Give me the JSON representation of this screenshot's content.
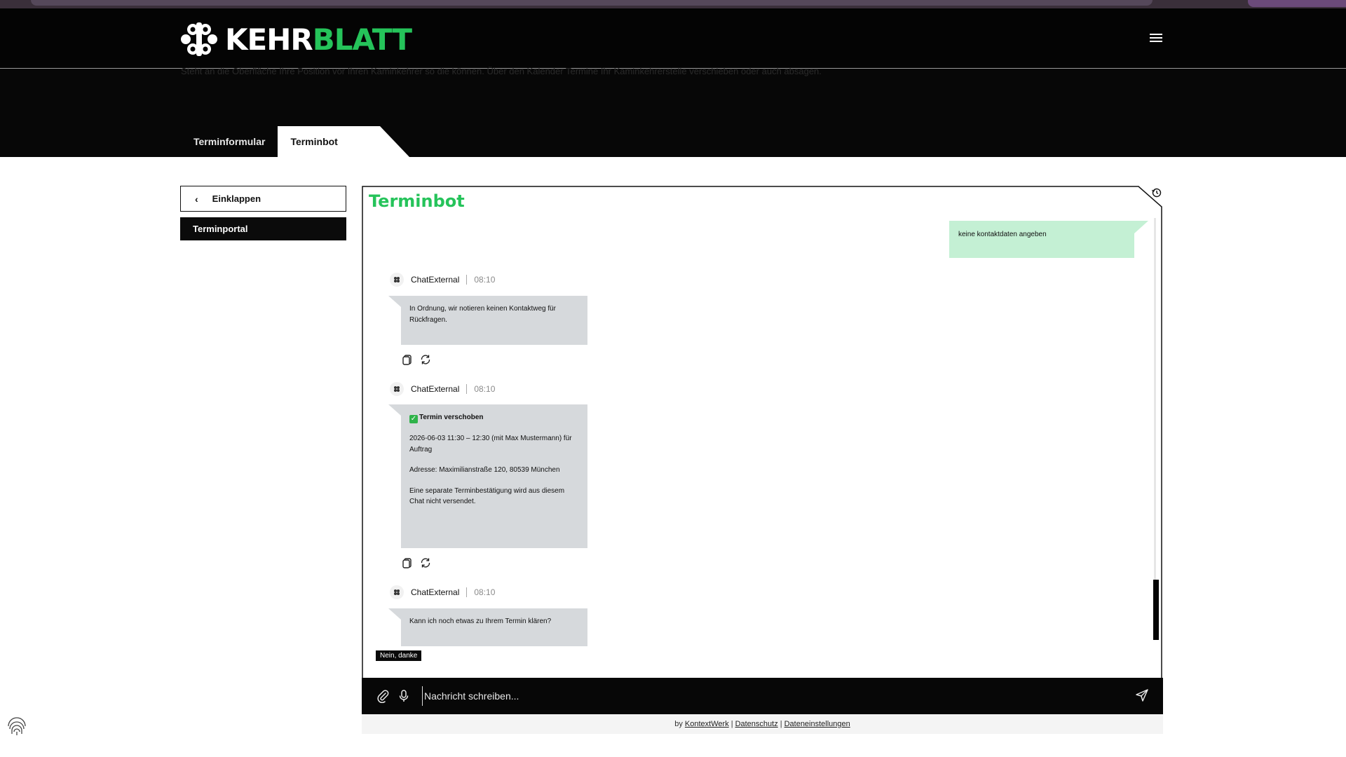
{
  "header": {
    "logo_word_white": "KEHR",
    "logo_word_green": "BLATT",
    "hero_text": "Steht an die Oberfläche Ihre Position vor Ihren Kaminkehrer so die können. Über den Kalender Termine Ihr Kaminkehrerstelle verschieben oder auch absagen."
  },
  "tabs": [
    {
      "label": "Terminformular",
      "active": false
    },
    {
      "label": "Terminbot",
      "active": true
    }
  ],
  "sidebar": {
    "collapse_label": "Einklappen",
    "portal_label": "Terminportal"
  },
  "chat": {
    "title": "Terminbot",
    "user_message": "keine kontaktdaten angeben",
    "messages": [
      {
        "author": "ChatExternal",
        "time": "08:10",
        "lines": [
          "In Ordnung, wir notieren keinen Kontaktweg für Rückfragen."
        ]
      },
      {
        "author": "ChatExternal",
        "time": "08:10",
        "heading": "Termin verschoben",
        "lines": [
          "2026-06-03 11:30 – 12:30 (mit Max Mustermann) für Auftrag",
          "Adresse: Maximilianstraße 120, 80539 München",
          "Eine separate Terminbestätigung wird aus diesem Chat nicht versendet."
        ]
      },
      {
        "author": "ChatExternal",
        "time": "08:10",
        "lines": [
          "Kann ich noch etwas zu Ihrem Termin klären?"
        ]
      }
    ],
    "quick_reply": "Nein, danke",
    "input_placeholder": "Nachricht schreiben..."
  },
  "footer": {
    "by": "by",
    "brand": "KontextWerk",
    "privacy": "Datenschutz",
    "settings": "Dateneinstellungen"
  },
  "colors": {
    "accent_green": "#25c35a",
    "user_bubble": "#c4f0d4",
    "bot_bubble": "#d6d9dc",
    "dark": "#070707"
  },
  "icons": [
    "menu-icon",
    "history-icon",
    "chevron-left-icon",
    "copy-icon",
    "refresh-icon",
    "paperclip-icon",
    "microphone-icon",
    "send-icon",
    "fingerprint-icon"
  ]
}
